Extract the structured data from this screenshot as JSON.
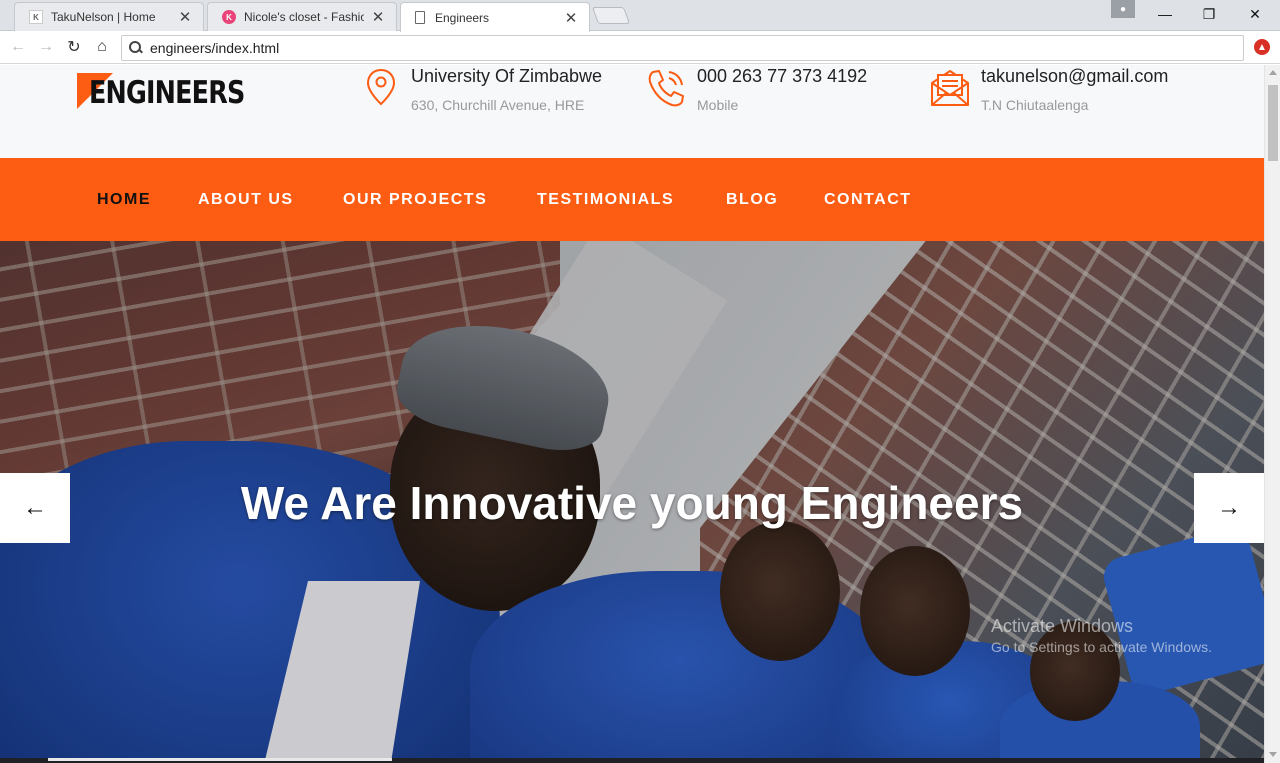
{
  "browser": {
    "tabs": [
      {
        "title": "TakuNelson | Home",
        "favicon": "K"
      },
      {
        "title": "Nicole's closet - Fashion",
        "favicon": "K"
      },
      {
        "title": "Engineers",
        "favicon": "page-icon"
      }
    ],
    "url": "engineers/index.html"
  },
  "site": {
    "logo_text": "ENGINEERS",
    "contacts": [
      {
        "icon": "location-pin-icon",
        "main": "University Of Zimbabwe",
        "sub": "630, Churchill Avenue, HRE"
      },
      {
        "icon": "phone-icon",
        "main": "000 263 77 373 4192",
        "sub": "Mobile"
      },
      {
        "icon": "envelope-icon",
        "main": "takunelson@gmail.com",
        "sub": "T.N Chiutaalenga"
      }
    ],
    "nav": [
      "HOME",
      "ABOUT US",
      "OUR PROJECTS",
      "TESTIMONIALS",
      "BLOG",
      "CONTACT"
    ],
    "active_nav": "HOME",
    "hero": {
      "caption_pre": "We Are ",
      "caption_bold": "Innovative",
      "caption_post": " young Engineers",
      "prev_arrow": "←",
      "next_arrow": "→"
    }
  },
  "watermark": {
    "line1": "Activate Windows",
    "line2": "Go to Settings to activate Windows."
  },
  "colors": {
    "accent": "#fd5c13",
    "topbar_bg": "#f7f8fa"
  }
}
